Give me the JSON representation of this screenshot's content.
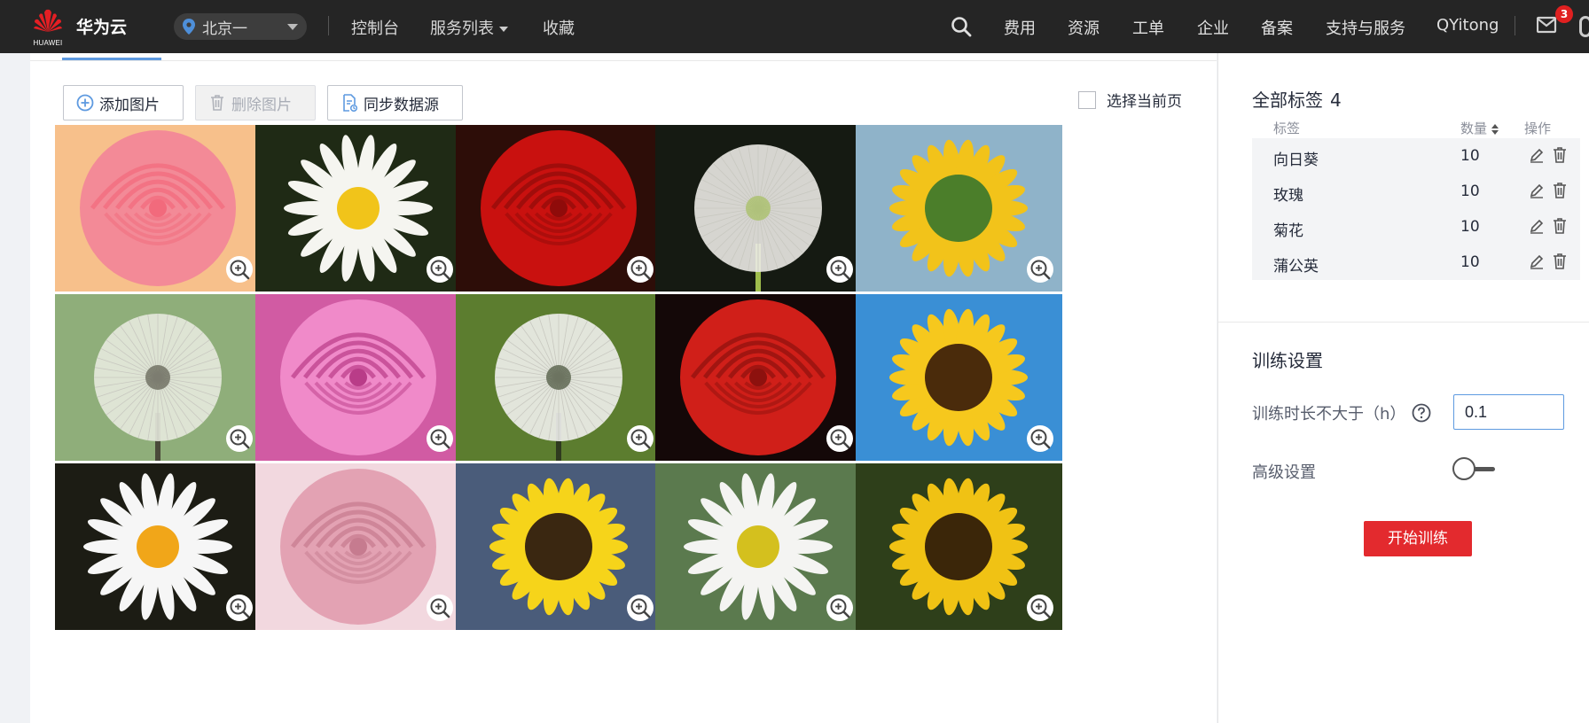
{
  "header": {
    "logo_text": "HUAWEI",
    "brand": "华为云",
    "region": "北京一",
    "nav_left": [
      "控制台",
      "服务列表",
      "收藏"
    ],
    "nav_right": [
      "费用",
      "资源",
      "工单",
      "企业",
      "备案",
      "支持与服务",
      "QYitong"
    ],
    "mail_badge": "3"
  },
  "toolbar": {
    "add_label": "添加图片",
    "delete_label": "删除图片",
    "sync_label": "同步数据源",
    "select_page_label": "选择当前页"
  },
  "gallery": {
    "images": [
      {
        "subject": "玫瑰",
        "palette": [
          "#f7c08b",
          "#f38a97",
          "#f26a7c"
        ]
      },
      {
        "subject": "菊花",
        "palette": [
          "#1f2a15",
          "#f5f5f0",
          "#f1c41a"
        ]
      },
      {
        "subject": "玫瑰",
        "palette": [
          "#2d0d08",
          "#c9110f",
          "#8f0b0a"
        ]
      },
      {
        "subject": "蒲公英",
        "palette": [
          "#151a12",
          "#ebeae6",
          "#9fbd4c"
        ]
      },
      {
        "subject": "向日葵",
        "palette": [
          "#8fb3c9",
          "#f2c31a",
          "#4b7e2a"
        ]
      },
      {
        "subject": "蒲公英",
        "palette": [
          "#8fae7a",
          "#e7eade",
          "#4a4a3a"
        ]
      },
      {
        "subject": "玫瑰",
        "palette": [
          "#d15ba3",
          "#f08ac9",
          "#b93c88"
        ]
      },
      {
        "subject": "蒲公英",
        "palette": [
          "#5c7d2f",
          "#f1f1ee",
          "#2f3a1f"
        ]
      },
      {
        "subject": "玫瑰",
        "palette": [
          "#140808",
          "#d01f19",
          "#8d110e"
        ]
      },
      {
        "subject": "向日葵",
        "palette": [
          "#3a8fd5",
          "#f6c81d",
          "#4a2b0b"
        ]
      },
      {
        "subject": "菊花",
        "palette": [
          "#1c1c14",
          "#f6f6f6",
          "#f1a619"
        ]
      },
      {
        "subject": "玫瑰",
        "palette": [
          "#f2d8df",
          "#e3a2b3",
          "#c67b8f"
        ]
      },
      {
        "subject": "向日葵",
        "palette": [
          "#4a5c7a",
          "#f6d41a",
          "#3a2711"
        ]
      },
      {
        "subject": "菊花",
        "palette": [
          "#5b7a4e",
          "#f4f4f2",
          "#d4c01e"
        ]
      },
      {
        "subject": "向日葵",
        "palette": [
          "#2e3f1a",
          "#f0c214",
          "#3b2609"
        ]
      }
    ]
  },
  "tags": {
    "title": "全部标签",
    "count": "4",
    "columns": {
      "tag": "标签",
      "count": "数量",
      "op": "操作"
    },
    "rows": [
      {
        "name": "向日葵",
        "count": "10"
      },
      {
        "name": "玫瑰",
        "count": "10"
      },
      {
        "name": "菊花",
        "count": "10"
      },
      {
        "name": "蒲公英",
        "count": "10"
      }
    ]
  },
  "training": {
    "title": "训练设置",
    "duration_label": "训练时长不大于（h）",
    "duration_value": "0.1",
    "advanced_label": "高级设置",
    "advanced_enabled": false,
    "start_label": "开始训练"
  },
  "colors": {
    "accent_red": "#e32a2e",
    "link_blue": "#5e9ae0",
    "topbar_bg": "#252525"
  }
}
